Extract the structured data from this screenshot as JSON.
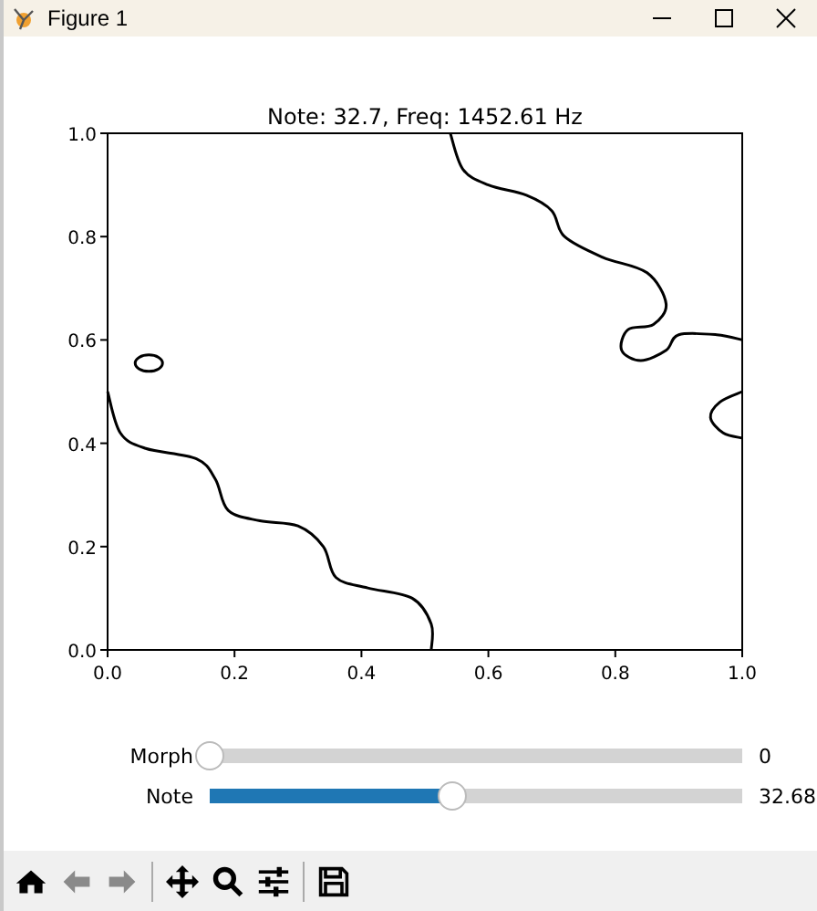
{
  "window": {
    "title": "Figure 1"
  },
  "plot": {
    "title": "Note: 32.7, Freq: 1452.61 Hz",
    "xticks": [
      "0.0",
      "0.2",
      "0.4",
      "0.6",
      "0.8",
      "1.0"
    ],
    "yticks": [
      "1.0",
      "0.8",
      "0.6",
      "0.4",
      "0.2",
      "0.0"
    ]
  },
  "sliders": [
    {
      "label": "Morph",
      "level": 0,
      "reading": "0"
    },
    {
      "label": "Note",
      "level": 0.455,
      "reading": "32.68"
    }
  ],
  "toolbar": [
    {
      "kind": "home",
      "disabled": false
    },
    {
      "kind": "back",
      "disabled": true
    },
    {
      "kind": "forward",
      "disabled": true
    },
    {
      "kind": "separator",
      "disabled": false
    },
    {
      "kind": "pan",
      "disabled": false
    },
    {
      "kind": "zoom",
      "disabled": false
    },
    {
      "kind": "configure",
      "disabled": false
    },
    {
      "kind": "separator",
      "disabled": false
    },
    {
      "kind": "save",
      "disabled": false
    }
  ]
}
